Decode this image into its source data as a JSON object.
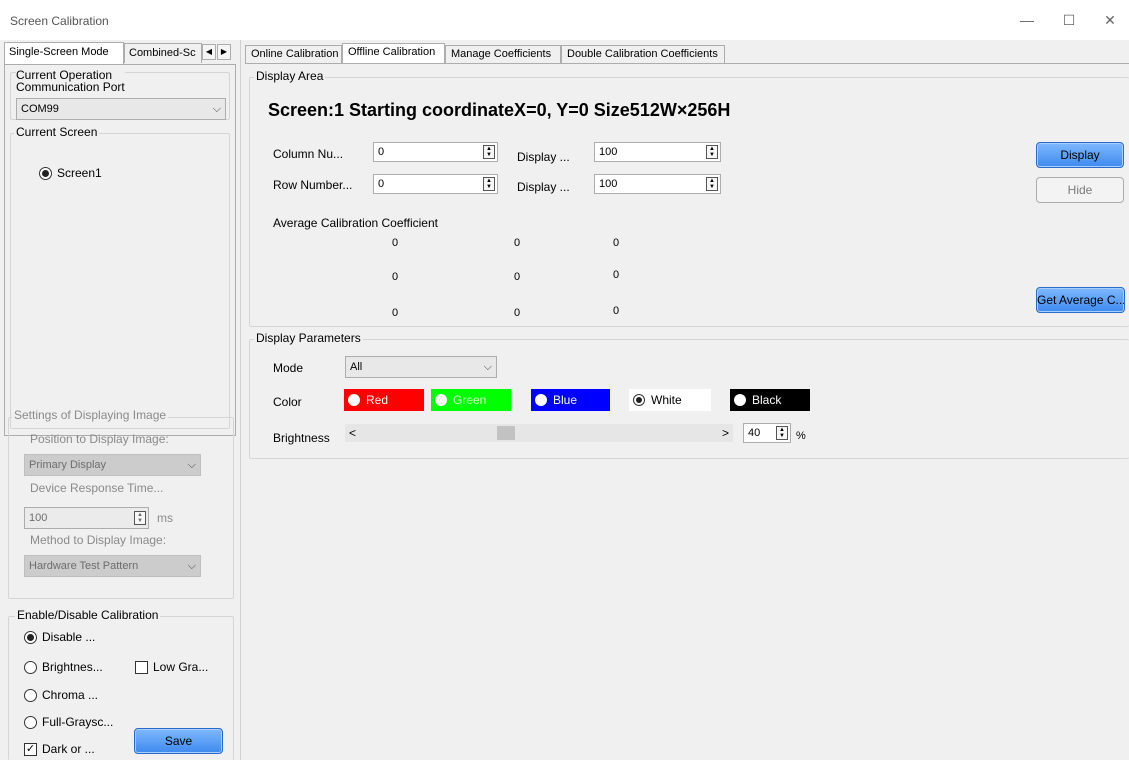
{
  "window": {
    "title": "Screen Calibration",
    "minimize": "—",
    "maximize": "☐",
    "close": "✕"
  },
  "left": {
    "tabs": [
      "Single-Screen Mode",
      "Combined-Sc"
    ],
    "operation_group": {
      "title_line1": "Current Operation",
      "title_line2": "Communication Port",
      "port_value": "COM99"
    },
    "screen_group": {
      "title": "Current Screen",
      "screen": "Screen1"
    },
    "display_image": {
      "title": "Settings of Displaying Image",
      "position_label": "Position to Display Image:",
      "position_value": "Primary Display",
      "response_label": "Device Response Time...",
      "response_value": "100",
      "response_unit": "ms",
      "method_label": "Method to Display Image:",
      "method_value": "Hardware Test Pattern"
    },
    "calibration": {
      "title": "Enable/Disable Calibration",
      "disable": "Disable ...",
      "brightness": "Brightnes...",
      "low_gray": "Low Gra...",
      "chroma": "Chroma ...",
      "full_gray": "Full-Graysc...",
      "dark": "Dark or ...",
      "save": "Save"
    }
  },
  "right": {
    "tabs": [
      "Online Calibration",
      "Offline Calibration",
      "Manage Coefficients",
      "Double Calibration Coefficients"
    ],
    "display_area": {
      "title": "Display Area",
      "heading": "Screen:1  Starting coordinateX=0, Y=0  Size512W×256H",
      "col_label": "Column Nu...",
      "col_value": "0",
      "row_label": "Row Number...",
      "row_value": "0",
      "disp1_label": "Display ...",
      "disp1_value": "100",
      "disp2_label": "Display ...",
      "disp2_value": "100",
      "display_btn": "Display",
      "hide_btn": "Hide",
      "avg_label": "Average Calibration Coefficient",
      "coeffs": [
        [
          "0",
          "0",
          "0"
        ],
        [
          "0",
          "0",
          "0"
        ],
        [
          "0",
          "0",
          "0"
        ]
      ],
      "get_avg_btn": "Get Average C..."
    },
    "params": {
      "title": "Display Parameters",
      "mode_label": "Mode",
      "mode_value": "All",
      "color_label": "Color",
      "colors": {
        "red": "Red",
        "green": "Green",
        "blue": "Blue",
        "white": "White",
        "black": "Black"
      },
      "brightness_label": "Brightness",
      "brightness_value": "40",
      "brightness_unit": "%",
      "slider_left": "<",
      "slider_right": ">",
      "slider_level_percent": 40
    }
  }
}
